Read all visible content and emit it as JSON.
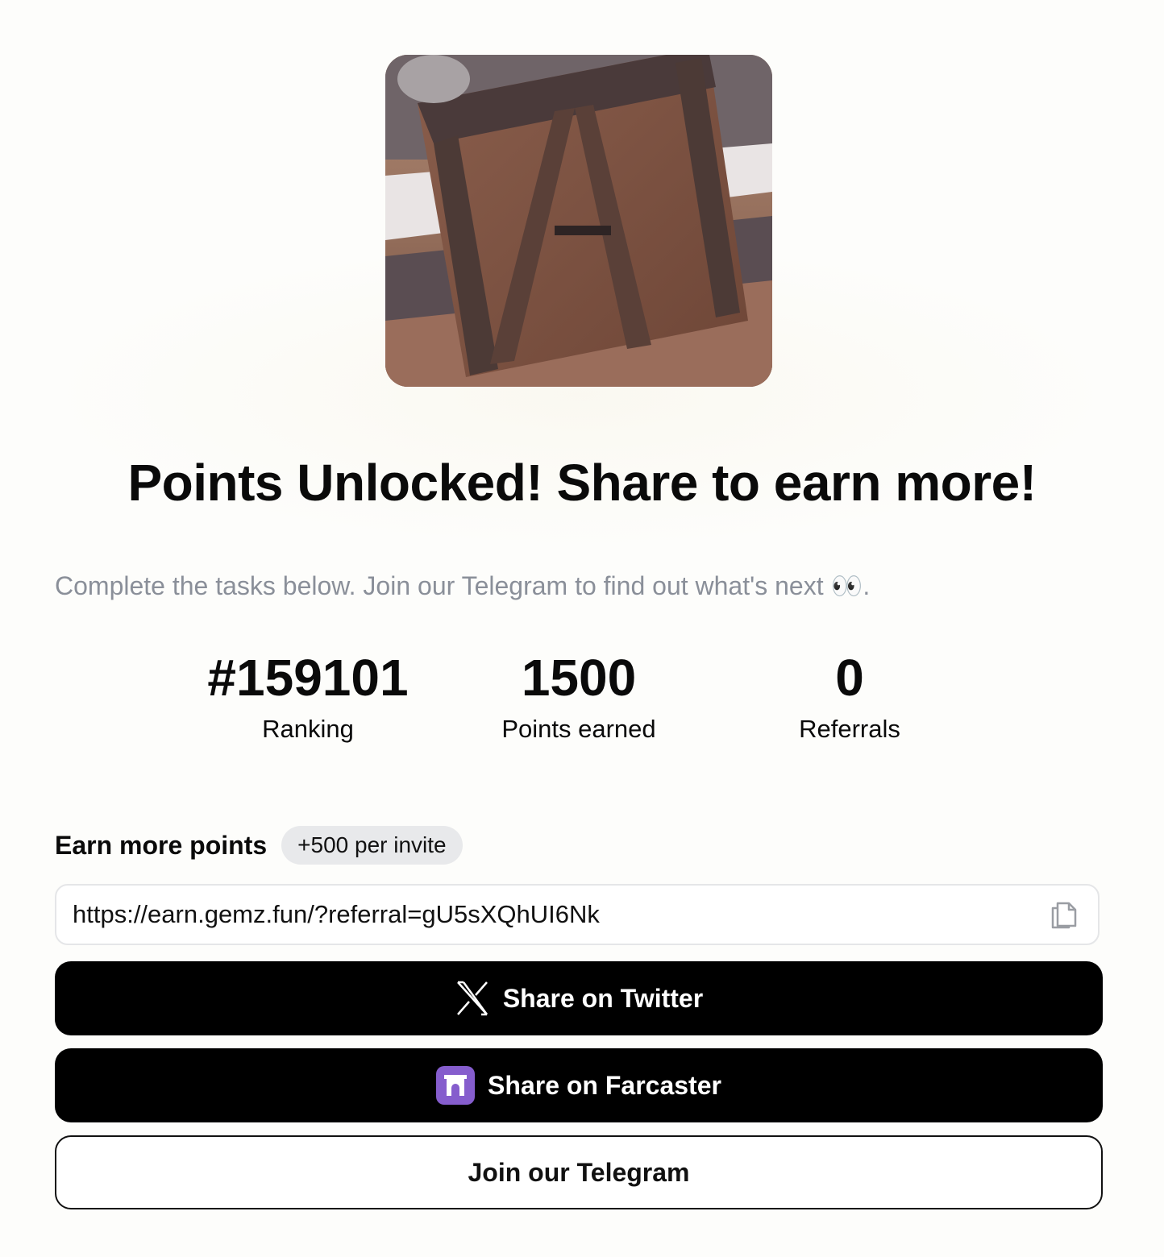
{
  "hero": {
    "image_alt": "animated wooden crate"
  },
  "title": "Points Unlocked! Share to earn more!",
  "subtitle": "Complete the tasks below. Join our Telegram to find out what's next 👀.",
  "stats": {
    "ranking": {
      "value": "#159101",
      "label": "Ranking"
    },
    "points": {
      "value": "1500",
      "label": "Points earned"
    },
    "referrals": {
      "value": "0",
      "label": "Referrals"
    }
  },
  "earn": {
    "title": "Earn more points",
    "badge": "+500 per invite"
  },
  "referral": {
    "link": "https://earn.gemz.fun/?referral=gU5sXQhUI6Nk",
    "copy_icon": "copy-icon"
  },
  "buttons": {
    "twitter": {
      "label": "Share on Twitter",
      "icon": "x-logo-icon"
    },
    "farcaster": {
      "label": "Share on Farcaster",
      "icon": "farcaster-logo-icon",
      "icon_color": "#855dcd"
    },
    "telegram": {
      "label": "Join our Telegram"
    }
  },
  "colors": {
    "background": "#fdfdfb",
    "subtitle": "#8a8f99",
    "button_dark": "#000000",
    "badge_bg": "#e8e9eb"
  }
}
